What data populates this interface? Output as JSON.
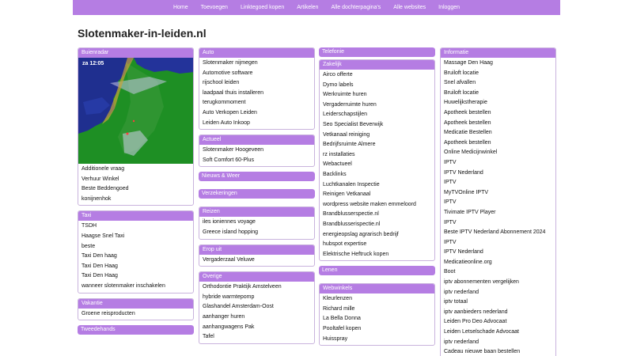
{
  "nav": [
    "Home",
    "Toevoegen",
    "Linktegoed kopen",
    "Artikelen",
    "Alle dochterpagina's",
    "Alle websites",
    "Inloggen"
  ],
  "site_title": "Slotenmaker-in-leiden.nl",
  "col1": {
    "buienradar": {
      "title": "Buienradar",
      "time": "za 12:05",
      "items": [
        "Additionele vraag",
        "Verhuur Winkel",
        "Beste Beddengoed",
        "konijnenhok"
      ]
    },
    "taxi": {
      "title": "Taxi",
      "items": [
        "TSDH",
        "Haagse Snel Taxi",
        "beste",
        "Taxi Den haag",
        "Taxi Den Haag",
        "Taxi Den Haag",
        "wanneer slotenmaker inschakelen"
      ]
    },
    "vakantie": {
      "title": "Vakantie",
      "items": [
        "Groene reisproducten"
      ]
    },
    "tweedehands": {
      "title": "Tweedehands"
    }
  },
  "col2": {
    "auto": {
      "title": "Auto",
      "items": [
        "Slotenmaker nijmegen",
        "Automotive software",
        "rijschool leiden",
        "laadpaal thuis installeren",
        "terugkommoment",
        "Auto Verkopen Leiden",
        "Leiden Auto Inkoop"
      ]
    },
    "actueel": {
      "title": "Actueel",
      "items": [
        "Slotenmaker Hoogeveen",
        "Soft Comfort 60-Plus"
      ]
    },
    "nieuws": {
      "title": "Nieuws & Weer"
    },
    "verzekeringen": {
      "title": "Verzekeringen"
    },
    "reizen": {
      "title": "Reizen",
      "items": [
        "iles ioniennes voyage",
        "Greece island hopping"
      ]
    },
    "eropuit": {
      "title": "Erop uit",
      "items": [
        "Vergaderzaal Veluwe"
      ]
    },
    "overige": {
      "title": "Overige",
      "items": [
        "Orthodontie Praktijk Amstelveen",
        "hybride warmtepomp",
        "Glashandel Amsterdam-Oost",
        "aanhanger huren",
        "aanhangwagens Pak",
        "Tafel"
      ]
    }
  },
  "col3": {
    "telefonie": {
      "title": "Telefonie"
    },
    "zakelijk": {
      "title": "Zakelijk",
      "items": [
        "Airco offerte",
        "Dymo labels",
        "Werkruimte huren",
        "Vergaderruimte huren",
        "Leiderschapstijlen",
        "Seo Specialist Beverwijk",
        "Vetkanaal reiniging",
        "Bedrijfsruimte Almere",
        "rz installaties",
        "Webactueel",
        "Backlinks",
        "Luchtkanalen Inspectie",
        "Reinigen Vetkanaal",
        "wordpress website maken emmeloord",
        "Brandblusserspectie.nl",
        "Brandblusserispectie.nl",
        "energieopslag agrarisch bedrijf",
        "hubspot expertise",
        "Elektrische Heftruck kopen"
      ]
    },
    "lenen": {
      "title": "Lenen"
    },
    "webwinkels": {
      "title": "Webwinkels",
      "items": [
        "Kleurlenzen",
        "Richard mille",
        "La Bella Donna",
        "Pooltafel kopen",
        "Huisspray"
      ]
    }
  },
  "col4": {
    "informatie": {
      "title": "Informatie",
      "items": [
        "Massage Den Haag",
        "Bruiloft locatie",
        "Snel afvallen",
        "Bruiloft locatie",
        "Huwelijkstherapie",
        "Apotheek bestellen",
        "Apotheek bestellen",
        "Medicatie Bestellen",
        "Apotheek bestellen",
        "Online Medicijnwinkel",
        "IPTV",
        "IPTV Nederland",
        "IPTV",
        "MyTVOnline IPTV",
        "IPTV",
        "Tivimate IPTV Player",
        "IPTV",
        "Beste IPTV Nederland Abonnement 2024",
        "IPTV",
        "IPTV Nederland",
        "Medicatieonline.org",
        "Boot",
        "iptv abonnementen vergelijken",
        "iptv nederland",
        "iptv totaal",
        "iptv aanbieders nederland",
        "Leiden Pro Deo Advocaat",
        "Leiden Letselschade Advocaat",
        "iptv nederland",
        "Cadeau nieuwe baan bestellen"
      ]
    }
  },
  "colors": {
    "accent": "#b57de3",
    "border": "#c9b3dd"
  }
}
